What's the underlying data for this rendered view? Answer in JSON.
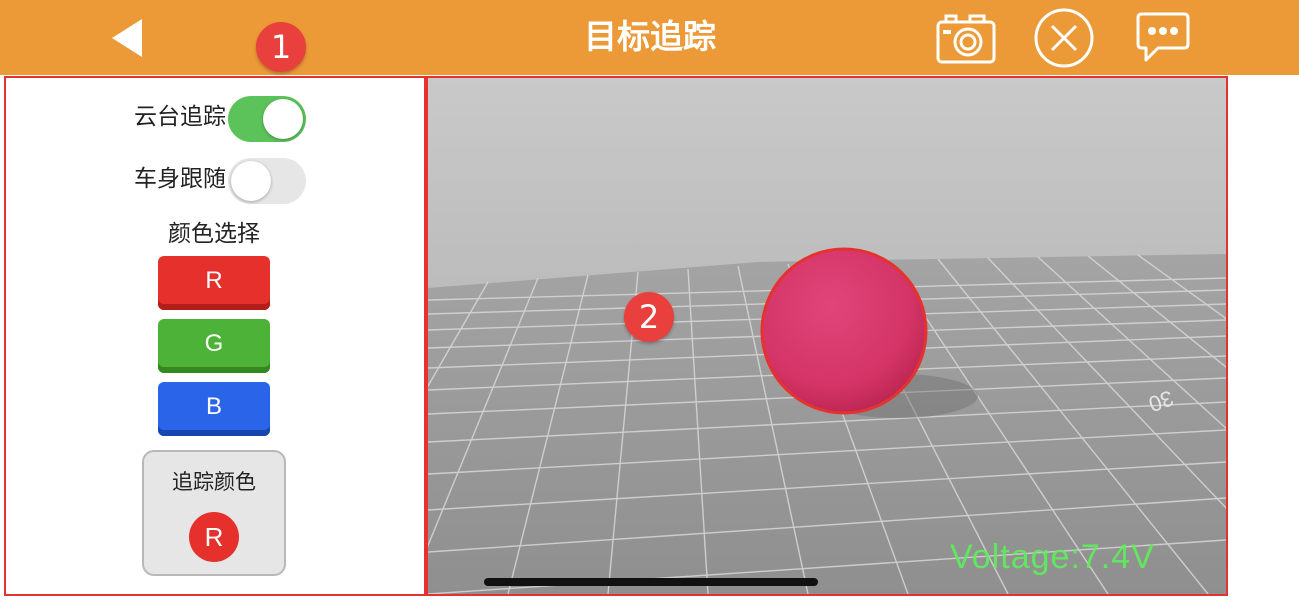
{
  "header": {
    "title": "目标追踪",
    "background_color": "#ec9a37",
    "icons": [
      "back-arrow-icon",
      "camera-icon",
      "close-circle-icon",
      "chat-bubble-icon"
    ]
  },
  "annotations": {
    "badge_1": "1",
    "badge_2": "2"
  },
  "sidebar": {
    "toggles": [
      {
        "label": "云台追踪",
        "state": "on"
      },
      {
        "label": "车身跟随",
        "state": "off"
      }
    ],
    "color_select_title": "颜色选择",
    "color_buttons": [
      {
        "label": "R",
        "color": "#e6302b"
      },
      {
        "label": "G",
        "color": "#4cb338"
      },
      {
        "label": "B",
        "color": "#2a64e8"
      }
    ],
    "track_color": {
      "label": "追踪颜色",
      "value": "R",
      "color": "#e6302b"
    }
  },
  "camera": {
    "voltage_text": "Voltage:7.4V",
    "mat_marking": "30",
    "target_object": "red-ball",
    "highlight_color": "#e5322f"
  }
}
